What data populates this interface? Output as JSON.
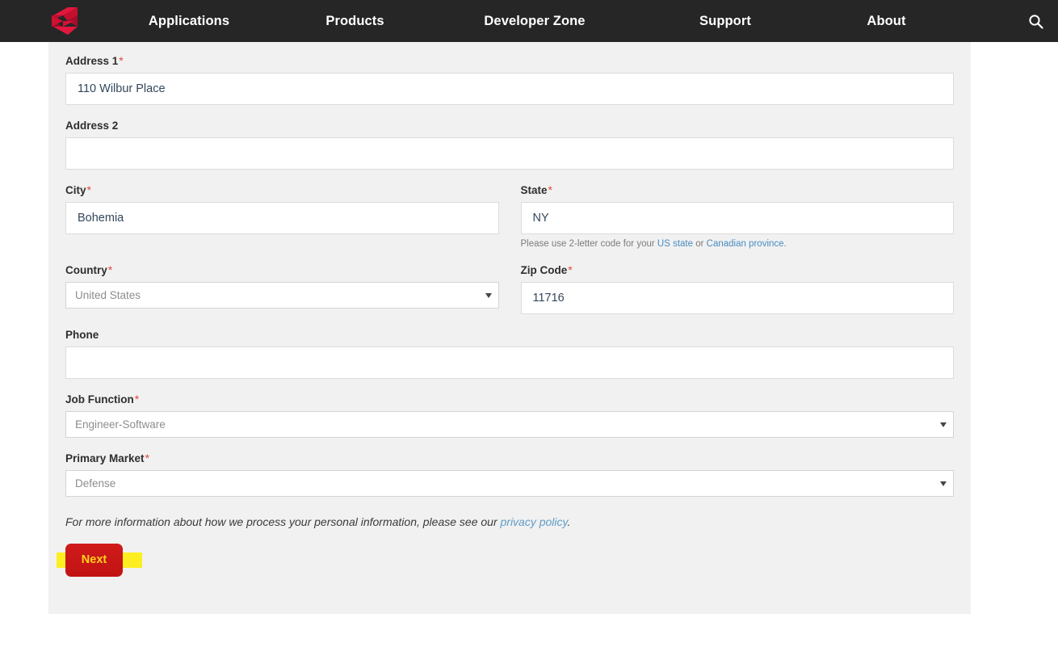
{
  "nav": {
    "logo_name": "brand-logo",
    "items": [
      {
        "label": "Applications"
      },
      {
        "label": "Products"
      },
      {
        "label": "Developer Zone"
      },
      {
        "label": "Support"
      },
      {
        "label": "About"
      }
    ],
    "search_icon": "search-icon"
  },
  "form": {
    "address1": {
      "label": "Address 1",
      "required": "*",
      "value": "110 Wilbur Place",
      "placeholder": ""
    },
    "address2": {
      "label": "Address 2",
      "required": "",
      "value": "",
      "placeholder": ""
    },
    "city": {
      "label": "City",
      "required": "*",
      "value": "Bohemia",
      "placeholder": ""
    },
    "state": {
      "label": "State",
      "required": "*",
      "value": "NY",
      "placeholder": "",
      "helper_prefix": "Please use 2-letter code for your ",
      "helper_link1": "US state",
      "helper_mid": " or ",
      "helper_link2": "Canadian province",
      "helper_suffix": "."
    },
    "country": {
      "label": "Country",
      "required": "*",
      "value": "United States",
      "arrow_icon": "chevron-down-icon"
    },
    "zip": {
      "label": "Zip Code",
      "required": "*",
      "value": "11716",
      "placeholder": ""
    },
    "phone": {
      "label": "Phone",
      "required": "",
      "value": "",
      "placeholder": ""
    },
    "job_function": {
      "label": "Job Function",
      "required": "*",
      "value": "Engineer-Software",
      "arrow_icon": "chevron-down-icon"
    },
    "primary_market": {
      "label": "Primary Market",
      "required": "*",
      "value": "Defense",
      "arrow_icon": "chevron-down-icon"
    },
    "privacy": {
      "text_before": "For more information about how we process your personal information, please see our ",
      "link": "privacy policy",
      "text_after": "."
    },
    "next_button": "Next"
  },
  "colors": {
    "nav_bg": "#262626",
    "panel_bg": "#f1f1f1",
    "brand_red": "#d01a1a",
    "required_red": "#e8453c",
    "link_blue": "#4a8cc0",
    "highlight_yellow": "#fcee21",
    "button_text_yellow": "#ffd21c"
  }
}
